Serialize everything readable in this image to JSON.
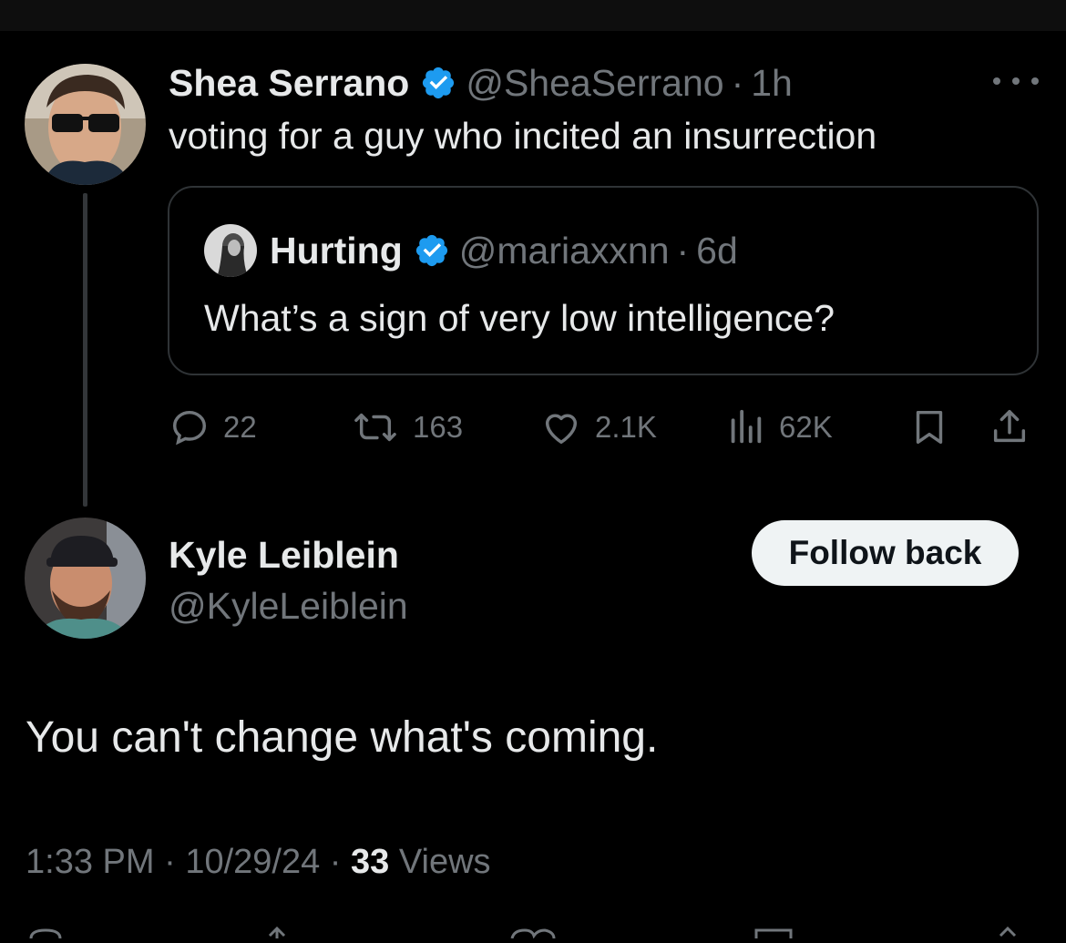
{
  "main_tweet": {
    "author_name": "Shea Serrano",
    "handle": "@SheaSerrano",
    "separator": "·",
    "time": "1h",
    "text": "voting for a guy who incited an insurrection",
    "verified_icon": "verified-badge-icon",
    "more_icon": "more-options-icon"
  },
  "quoted_tweet": {
    "author_name": "Hurting",
    "handle": "@mariaxxnn",
    "separator": "·",
    "time": "6d",
    "text": "What’s a sign of very low intelligence?"
  },
  "actions": {
    "replies": "22",
    "reposts": "163",
    "likes": "2.1K",
    "views": "62K"
  },
  "reply": {
    "author_name": "Kyle Leiblein",
    "handle": "@KyleLeiblein",
    "follow_button_label": "Follow back",
    "text": "You can't change what's coming.",
    "time": "1:33 PM",
    "separator": "·",
    "date": "10/29/24",
    "view_count": "33",
    "views_label": "Views"
  },
  "colors": {
    "background": "#000000",
    "text_primary": "#e7e9ea",
    "text_secondary": "#71767b",
    "verified_blue": "#1d9bf0",
    "border": "#2f3336",
    "button_bg": "#eff3f4"
  }
}
